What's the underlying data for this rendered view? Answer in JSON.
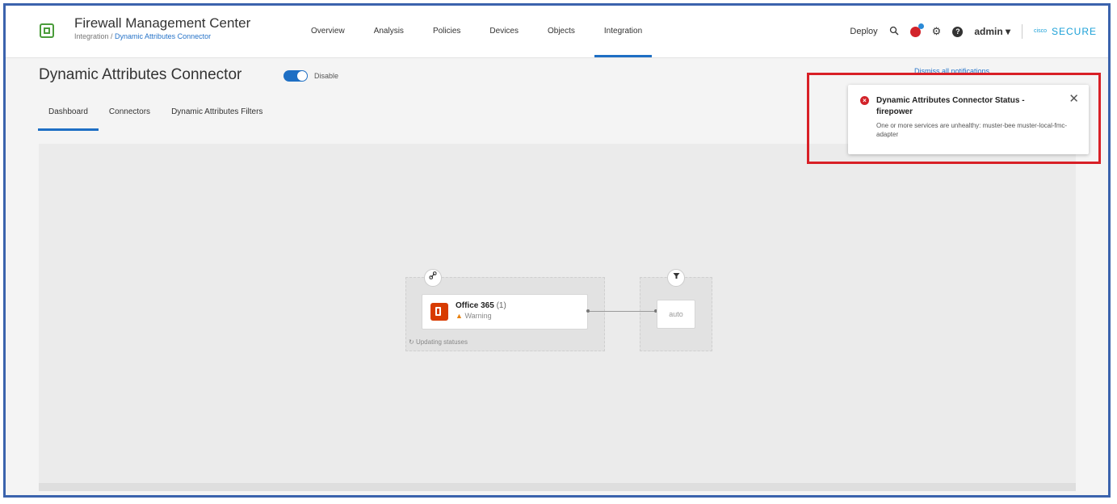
{
  "header": {
    "app_title": "Firewall Management Center",
    "breadcrumb_parent": "Integration /",
    "breadcrumb_current": "Dynamic Attributes Connector",
    "nav": [
      "Overview",
      "Analysis",
      "Policies",
      "Devices",
      "Objects",
      "Integration"
    ],
    "active_nav": "Integration",
    "deploy_label": "Deploy",
    "user_label": "admin ▾",
    "brand_mark": "cisco",
    "brand_text": "SECURE"
  },
  "page": {
    "title": "Dynamic Attributes Connector",
    "toggle_label": "Disable",
    "tabs": [
      "Dashboard",
      "Connectors",
      "Dynamic Attributes Filters"
    ],
    "active_tab": "Dashboard"
  },
  "diagram": {
    "connector_name": "Office 365",
    "connector_count": "(1)",
    "connector_status": "Warning",
    "updating_text": "Updating statuses",
    "filter_name": "auto"
  },
  "notification": {
    "dismiss_text": "Dismiss all notifications",
    "title": "Dynamic Attributes Connector Status - firepower",
    "message": "One or more services are unhealthy: muster-bee muster-local-fmc-adapter"
  },
  "colors": {
    "accent": "#1e6fc4",
    "error": "#d2232a",
    "highlight_border": "#d81f26",
    "office_orange": "#d83b01",
    "brand": "#1ba0d7"
  }
}
